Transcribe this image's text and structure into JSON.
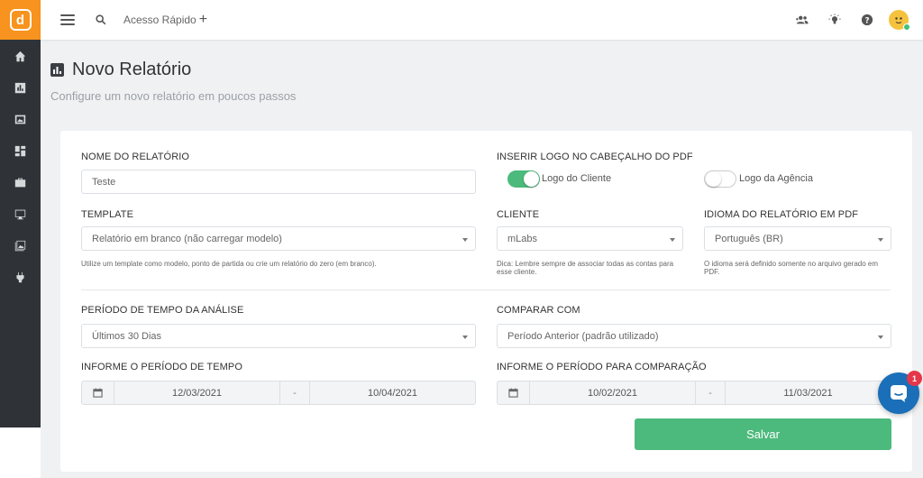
{
  "brand": {
    "logo_letter": "d",
    "accent": "#f7931e",
    "success": "#4cba7c",
    "sidebar_bg": "#2f3337"
  },
  "sidebar": {
    "items": [
      {
        "icon": "home-icon"
      },
      {
        "icon": "chart-icon"
      },
      {
        "icon": "image-icon"
      },
      {
        "icon": "dashboard-icon"
      },
      {
        "icon": "briefcase-icon"
      },
      {
        "icon": "monitor-icon"
      },
      {
        "icon": "gallery-icon"
      },
      {
        "icon": "plug-icon"
      }
    ]
  },
  "topbar": {
    "quick_access": "Acesso Rápido",
    "quick_access_plus": "+",
    "icons": [
      "users-icon",
      "lightbulb-icon",
      "help-icon",
      "avatar"
    ]
  },
  "page": {
    "title": "Novo Relatório",
    "subtitle": "Configure um novo relatório em poucos passos"
  },
  "form": {
    "report_name_label": "NOME DO RELATÓRIO",
    "report_name_value": "Teste",
    "logo_label": "INSERIR LOGO NO CABEÇALHO DO PDF",
    "logo_client_label": "Logo do Cliente",
    "logo_client_on": true,
    "logo_agency_label": "Logo da Agência",
    "logo_agency_on": false,
    "template_label": "TEMPLATE",
    "template_value": "Relatório em branco (não carregar modelo)",
    "template_hint": "Utilize um template como modelo, ponto de partida ou crie um relatório do zero (em branco).",
    "client_label": "CLIENTE",
    "client_value": "mLabs",
    "client_hint": "Dica: Lembre sempre de associar todas as contas para esse cliente.",
    "language_label": "IDIOMA DO RELATÓRIO EM PDF",
    "language_value": "Português (BR)",
    "language_hint": "O idioma será definido somente no arquivo gerado em PDF.",
    "period_label": "PERÍODO DE TEMPO DA ANÁLISE",
    "period_value": "Últimos 30 Dias",
    "compare_label": "COMPARAR COM",
    "compare_value": "Período Anterior (padrão utilizado)",
    "range_label": "INFORME O PERÍODO DE TEMPO",
    "range_start": "12/03/2021",
    "range_sep": "-",
    "range_end": "10/04/2021",
    "compare_range_label": "INFORME O PERÍODO PARA COMPARAÇÃO",
    "compare_start": "10/02/2021",
    "compare_end": "11/03/2021",
    "save_label": "Salvar"
  },
  "chat": {
    "badge": "1"
  }
}
